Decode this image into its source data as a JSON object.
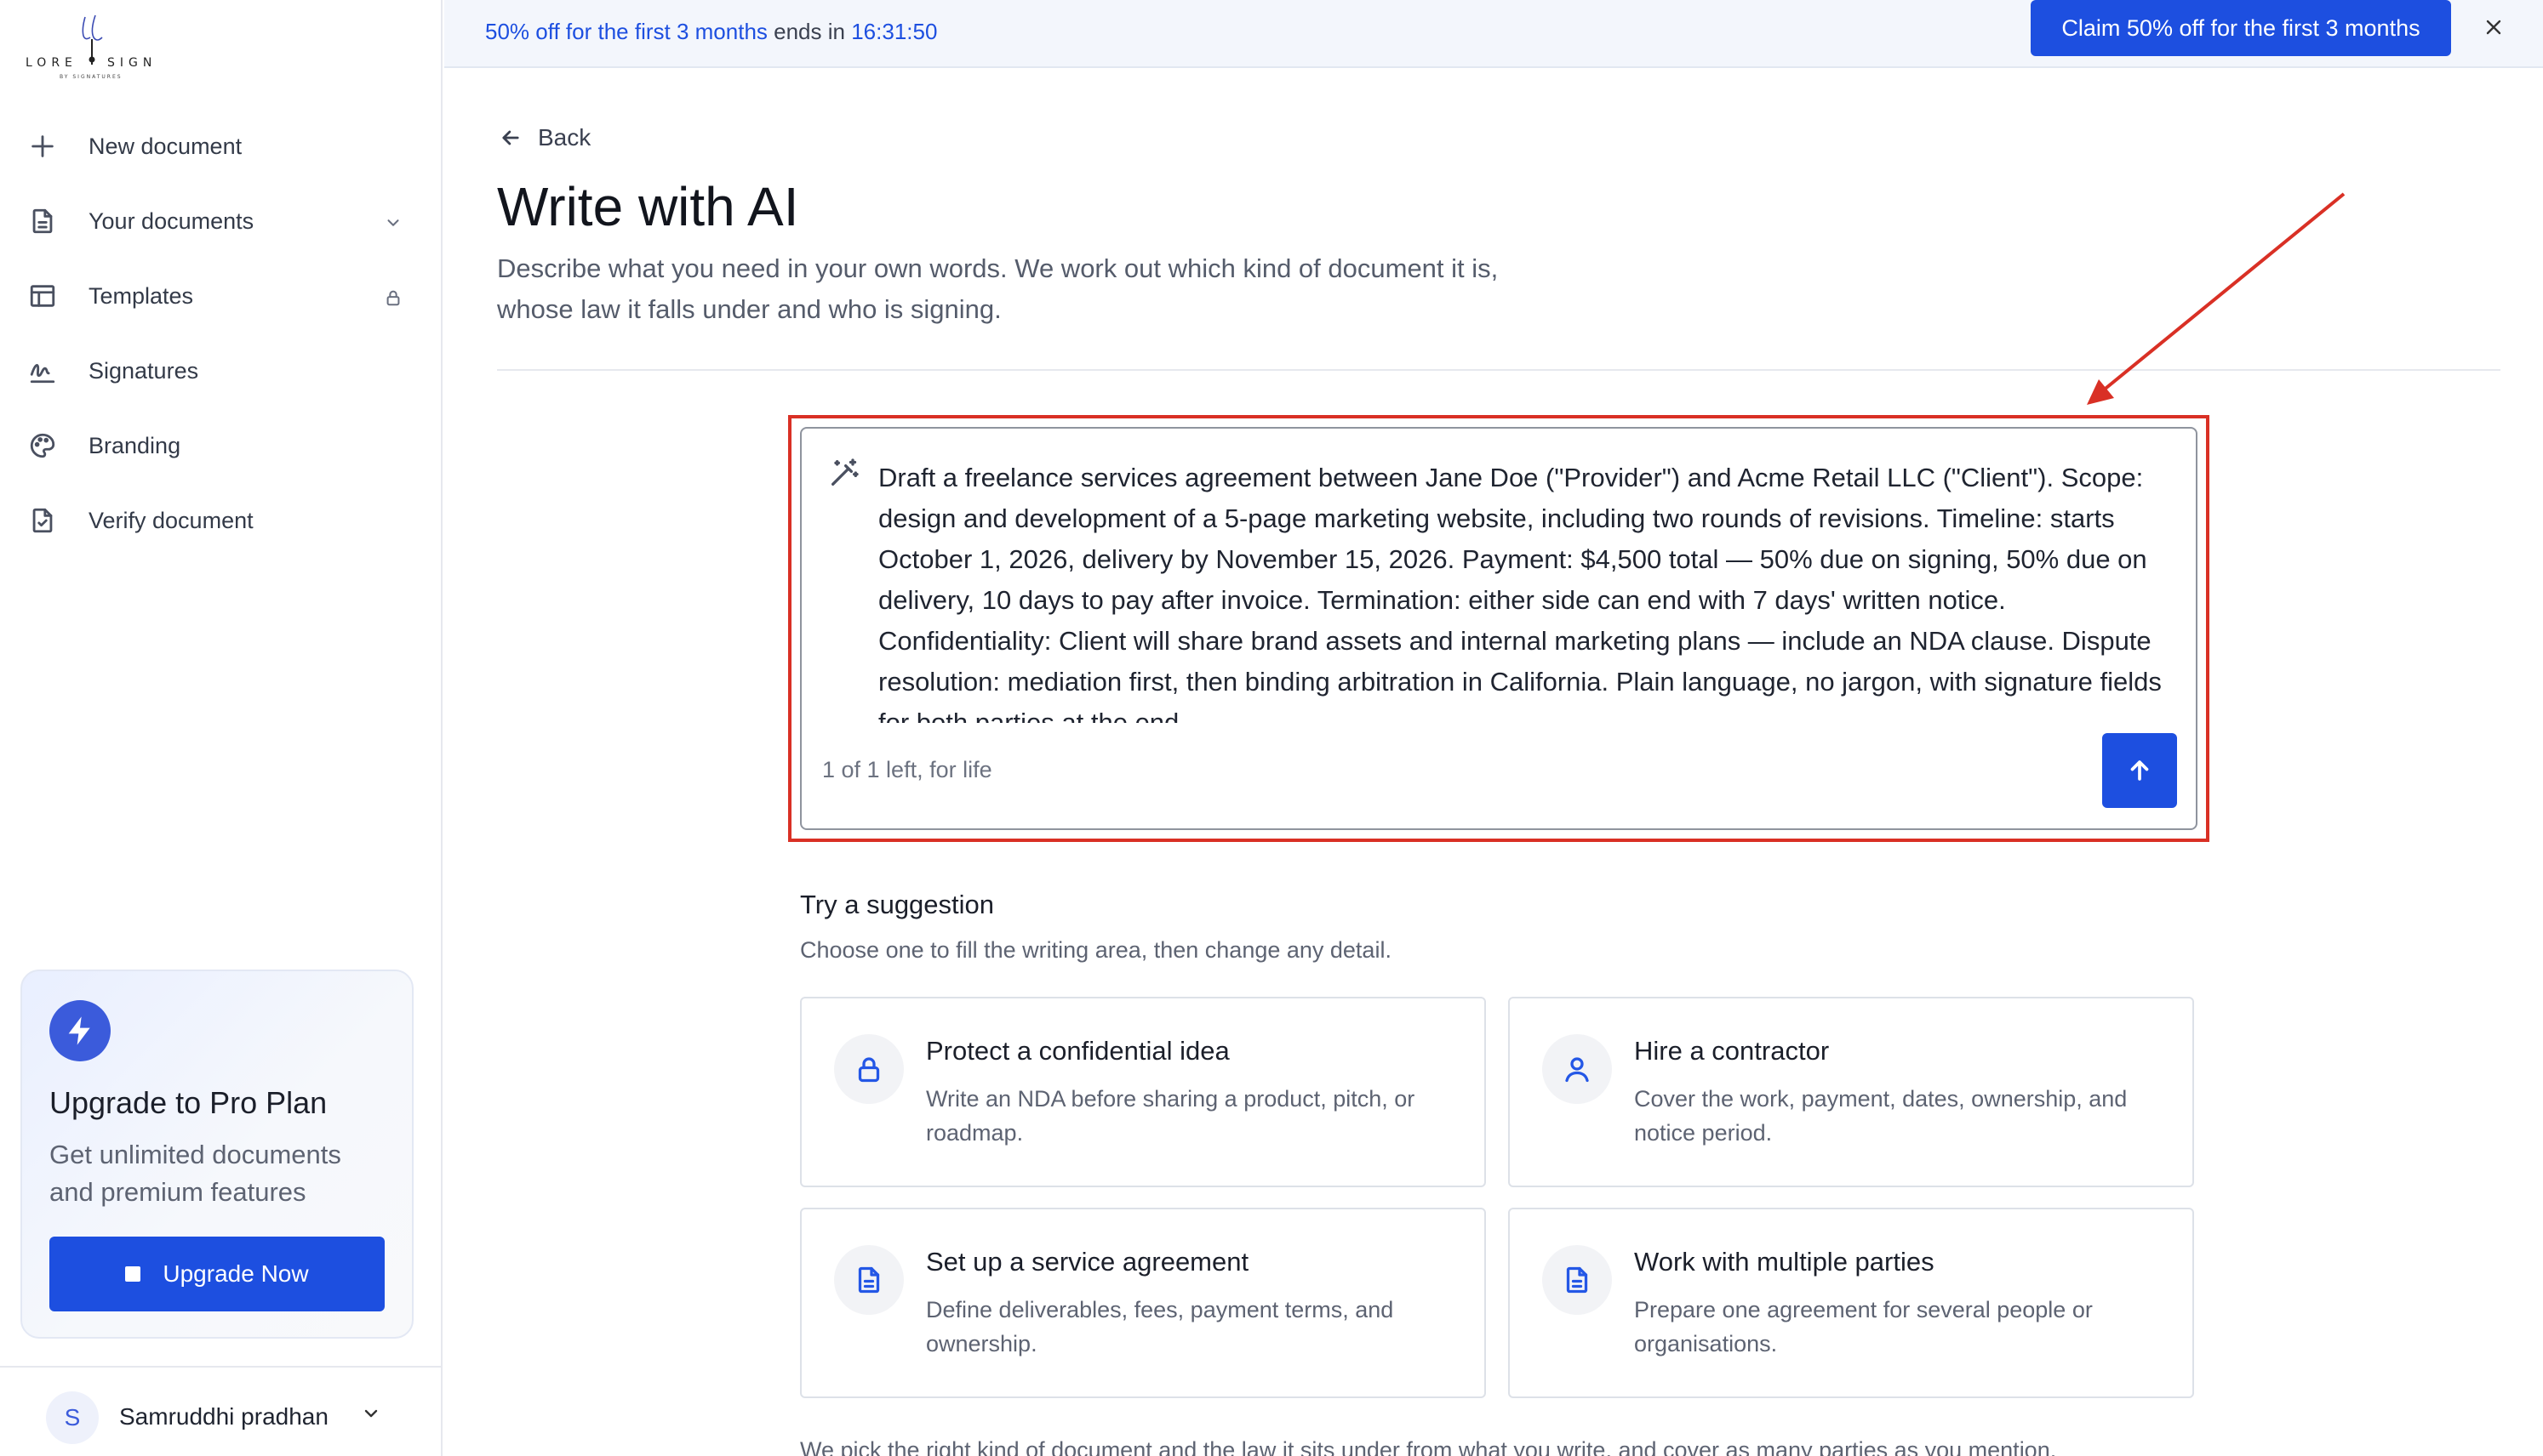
{
  "brand": {
    "name": "LORE SIGN",
    "tagline": "BY SIGNATURES"
  },
  "sidebar": {
    "items": [
      {
        "label": "New document",
        "icon": "plus-icon"
      },
      {
        "label": "Your documents",
        "icon": "document-icon"
      },
      {
        "label": "Templates",
        "icon": "templates-icon"
      },
      {
        "label": "Signatures",
        "icon": "signature-icon"
      },
      {
        "label": "Branding",
        "icon": "palette-icon"
      },
      {
        "label": "Verify document",
        "icon": "verify-document-icon"
      }
    ],
    "upgrade": {
      "title": "Upgrade to Pro Plan",
      "description": "Get unlimited documents and premium features",
      "button": "Upgrade Now"
    },
    "user": {
      "initial": "S",
      "name": "Samruddhi pradhan"
    }
  },
  "banner": {
    "offer": "50% off for the first 3 months",
    "ends_in": "ends in",
    "timer": "16:31:50",
    "cta": "Claim 50% off for the first 3 months"
  },
  "main": {
    "back": "Back",
    "title": "Write with AI",
    "subtitle": "Describe what you need in your own words. We work out which kind of document it is, whose law it falls under and who is signing.",
    "composer": {
      "prompt": "Draft a freelance services agreement between Jane Doe (\"Provider\") and Acme Retail LLC (\"Client\"). Scope: design and development of a 5-page marketing website, including two rounds of revisions. Timeline: starts October 1, 2026, delivery by November 15, 2026. Payment: $4,500 total — 50% due on signing, 50% due on delivery, 10 days to pay after invoice. Termination: either side can end with 7 days' written notice. Confidentiality: Client will share brand assets and internal marketing plans — include an NDA clause. Dispute resolution: mediation first, then binding arbitration in California. Plain language, no jargon, with signature fields for both parties at the end.",
      "counter": "1 of 1 left, for life"
    },
    "suggestions": {
      "title": "Try a suggestion",
      "subtitle": "Choose one to fill the writing area, then change any detail.",
      "cards": [
        {
          "title": "Protect a confidential idea",
          "description": "Write an NDA before sharing a product, pitch, or roadmap.",
          "icon": "lock-icon"
        },
        {
          "title": "Hire a contractor",
          "description": "Cover the work, payment, dates, ownership, and notice period.",
          "icon": "person-icon"
        },
        {
          "title": "Set up a service agreement",
          "description": "Define deliverables, fees, payment terms, and ownership.",
          "icon": "document-icon"
        },
        {
          "title": "Work with multiple parties",
          "description": "Prepare one agreement for several people or organisations.",
          "icon": "document-icon"
        }
      ]
    },
    "footnote": "We pick the right kind of document and the law it sits under from what you write, and cover as many parties as you mention."
  },
  "colors": {
    "accent": "#1d4fe0",
    "annotation": "#d93025",
    "sidebar_border": "#e6e8ee"
  }
}
